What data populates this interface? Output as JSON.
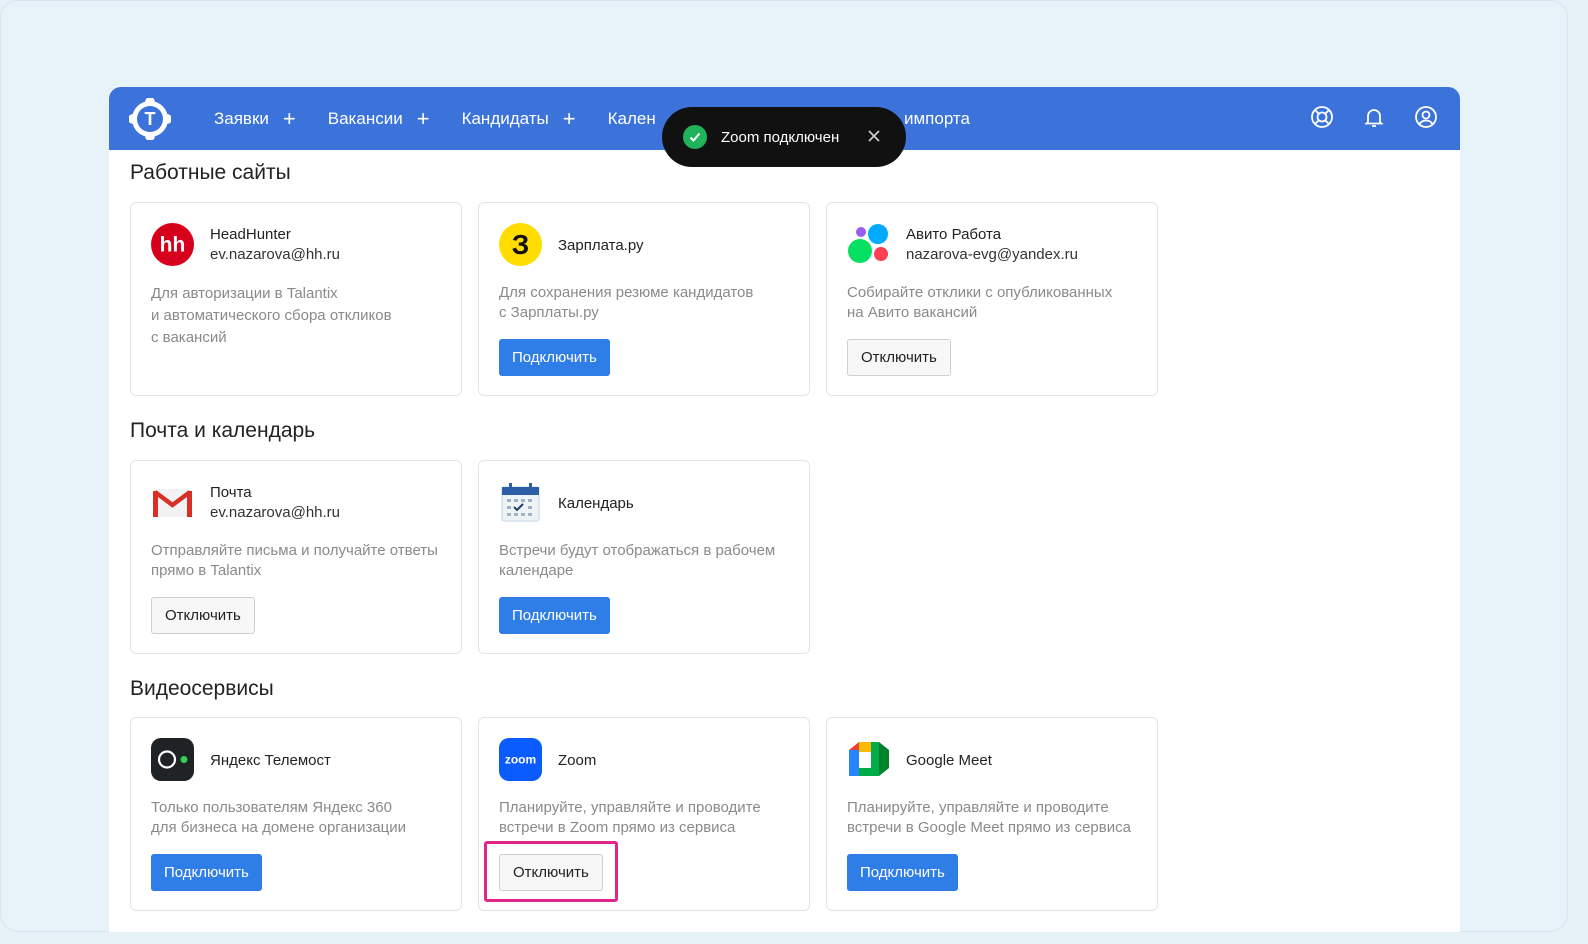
{
  "nav": {
    "items": [
      {
        "label": "Заявки"
      },
      {
        "label": "Вакансии"
      },
      {
        "label": "Кандидаты"
      },
      {
        "label": "Кален"
      }
    ],
    "import_label": "импорта",
    "plus": "+"
  },
  "toast": {
    "message": "Zoom подключен"
  },
  "sections": {
    "job_sites": "Работные сайты",
    "mail_calendar": "Почта и календарь",
    "video": "Видеосервисы"
  },
  "cards": {
    "hh": {
      "name": "HeadHunter",
      "account": "ev.nazarova@hh.ru",
      "desc": "Для авторизации в Talantix\nи автоматического сбора откликов\nс вакансий",
      "icon": "headhunter-logo"
    },
    "zarplata": {
      "name": "Зарплата.ру",
      "desc": "Для сохранения резюме кандидатов\nс Зарплаты.ру",
      "button": "Подключить",
      "icon": "zarplata-logo"
    },
    "avito": {
      "name": "Авито Работа",
      "account": "nazarova-evg@yandex.ru",
      "desc": "Собирайте отклики с опубликованных\nна Авито вакансий",
      "button": "Отключить",
      "icon": "avito-logo"
    },
    "mail": {
      "name": "Почта",
      "account": "ev.nazarova@hh.ru",
      "desc": "Отправляйте письма и получайте ответы\nпрямо в Talantix",
      "button": "Отключить",
      "icon": "gmail-icon"
    },
    "calendar": {
      "name": "Календарь",
      "desc": "Встречи будут отображаться в рабочем\nкалендаре",
      "button": "Подключить",
      "icon": "calendar-icon"
    },
    "telemost": {
      "name": "Яндекс Телемост",
      "desc": "Только пользователям Яндекс 360\nдля бизнеса на домене организации",
      "button": "Подключить",
      "icon": "telemost-logo"
    },
    "zoom": {
      "name": "Zoom",
      "logo_text": "zoom",
      "desc": "Планируйте, управляйте и проводите\nвстречи в Zoom прямо из сервиса",
      "button": "Отключить",
      "icon": "zoom-logo"
    },
    "meet": {
      "name": "Google Meet",
      "desc": "Планируйте, управляйте и проводите\nвстречи в Google Meet прямо из сервиса",
      "button": "Подключить",
      "icon": "google-meet-logo"
    }
  },
  "colors": {
    "topbar": "#3b73db",
    "primary_button": "#2f7ee8",
    "highlight": "#e0268a",
    "toast_bg": "#111111",
    "success": "#21b35b"
  }
}
